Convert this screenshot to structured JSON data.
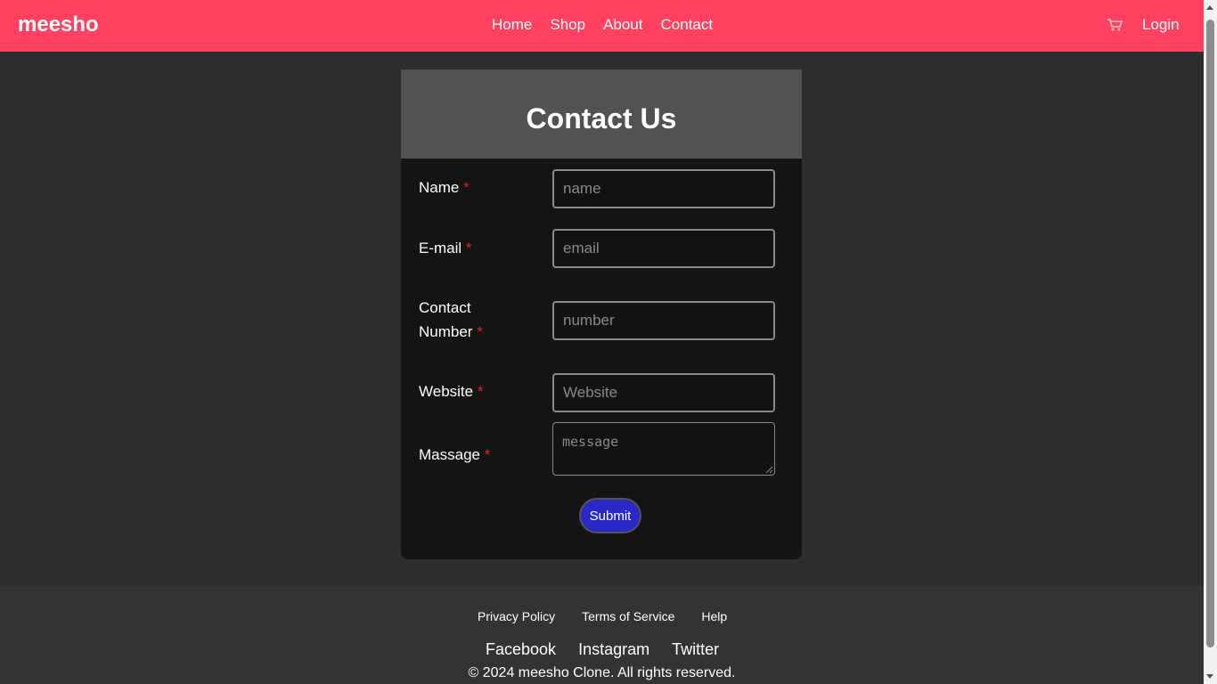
{
  "navbar": {
    "brand": "meesho",
    "links": [
      "Home",
      "Shop",
      "About",
      "Contact"
    ],
    "cart_icon": "cart-icon",
    "login": "Login",
    "color": "#ff4161"
  },
  "contact": {
    "title": "Contact Us",
    "required_mark": "*",
    "fields": {
      "name": {
        "label": "Name",
        "placeholder": "name",
        "value": ""
      },
      "email": {
        "label": "E-mail",
        "placeholder": "email",
        "value": ""
      },
      "contact_number": {
        "label_line1": "Contact",
        "label_line2": "Number",
        "placeholder": "number",
        "value": ""
      },
      "website": {
        "label": "Website",
        "placeholder": "Website",
        "value": ""
      },
      "message": {
        "label": "Massage",
        "placeholder": "message",
        "value": ""
      }
    },
    "submit": "Submit",
    "submit_color": "#2a28c8"
  },
  "footer": {
    "links": [
      "Privacy Policy",
      "Terms of Service",
      "Help"
    ],
    "social": [
      "Facebook",
      "Instagram",
      "Twitter"
    ],
    "copyright": "© 2024 meesho Clone. All rights reserved."
  }
}
